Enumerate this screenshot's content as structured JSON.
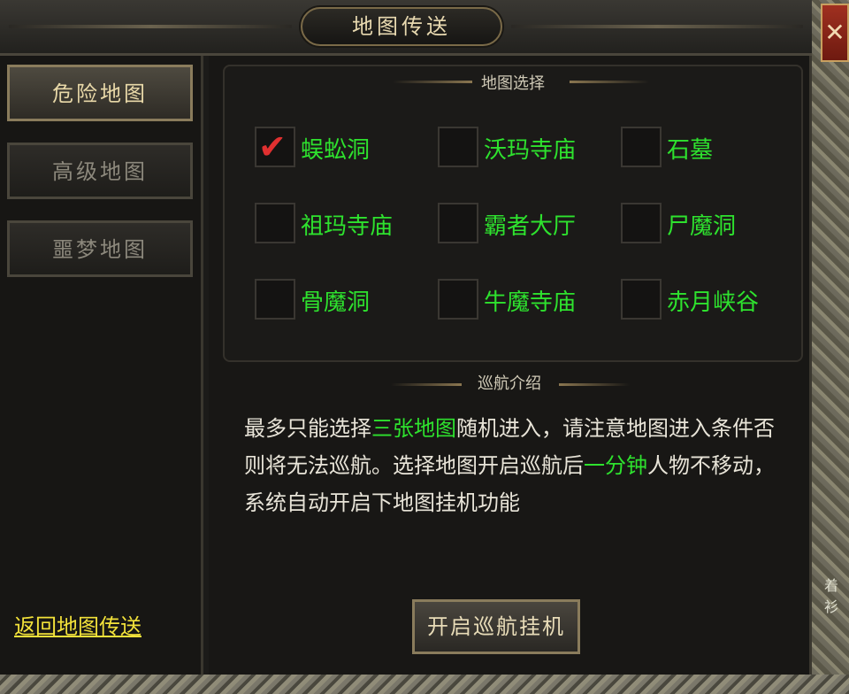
{
  "window": {
    "title": "地图传送"
  },
  "sidebar": {
    "tabs": [
      {
        "label": "危险地图",
        "active": true
      },
      {
        "label": "高级地图",
        "active": false
      },
      {
        "label": "噩梦地图",
        "active": false
      }
    ],
    "back_link": "返回地图传送"
  },
  "map_select": {
    "title": "地图选择",
    "maps": [
      {
        "name": "蜈蚣洞",
        "checked": true
      },
      {
        "name": "沃玛寺庙",
        "checked": false
      },
      {
        "name": "石墓",
        "checked": false
      },
      {
        "name": "祖玛寺庙",
        "checked": false
      },
      {
        "name": "霸者大厅",
        "checked": false
      },
      {
        "name": "尸魔洞",
        "checked": false
      },
      {
        "name": "骨魔洞",
        "checked": false
      },
      {
        "name": "牛魔寺庙",
        "checked": false
      },
      {
        "name": "赤月峡谷",
        "checked": false
      }
    ]
  },
  "intro": {
    "title": "巡航介绍",
    "p1": "最多只能选择",
    "p2": "三张地图",
    "p3": "随机进入，请注意地图进入条件否则将无法巡航。选择地图开启巡航后",
    "p4": "一分钟",
    "p5": "人物不移动，系统自动开启下地图挂机功能"
  },
  "start_button": "开启巡航挂机",
  "close_button": "✕",
  "background_text": "着衫",
  "colors": {
    "highlight_green": "#2ee22e",
    "link_yellow": "#f2e13a",
    "check_red": "#e03030"
  }
}
